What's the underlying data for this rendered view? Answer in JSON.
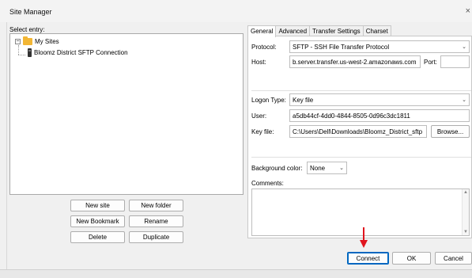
{
  "window": {
    "title": "Site Manager",
    "close_glyph": "×"
  },
  "left": {
    "select_entry_label": "Select entry:",
    "tree": {
      "root": {
        "label": "My Sites",
        "expander": "−"
      },
      "child": {
        "label": "Bloomz District SFTP Connection"
      }
    },
    "buttons": {
      "new_site": "New site",
      "new_folder": "New folder",
      "new_bookmark": "New Bookmark",
      "rename": "Rename",
      "delete": "Delete",
      "duplicate": "Duplicate"
    }
  },
  "tabs": [
    "General",
    "Advanced",
    "Transfer Settings",
    "Charset"
  ],
  "general": {
    "protocol_label": "Protocol:",
    "protocol_value": "SFTP - SSH File Transfer Protocol",
    "host_label": "Host:",
    "host_value": "b.server.transfer.us-west-2.amazonaws.com",
    "port_label": "Port:",
    "port_value": "",
    "logon_type_label": "Logon Type:",
    "logon_type_value": "Key file",
    "user_label": "User:",
    "user_value": "a5db44cf-4dd0-4844-8505-0d96c3dc1811",
    "key_file_label": "Key file:",
    "key_file_value": "C:\\Users\\Dell\\Downloads\\Bloomz_District_sftp",
    "browse_label": "Browse...",
    "background_color_label": "Background color:",
    "background_color_value": "None",
    "comments_label": "Comments:"
  },
  "footer": {
    "connect": "Connect",
    "ok": "OK",
    "cancel": "Cancel"
  },
  "colors": {
    "annotation_arrow": "#e0141e",
    "folder": "#f2b635",
    "focus_border": "#0067c0"
  }
}
